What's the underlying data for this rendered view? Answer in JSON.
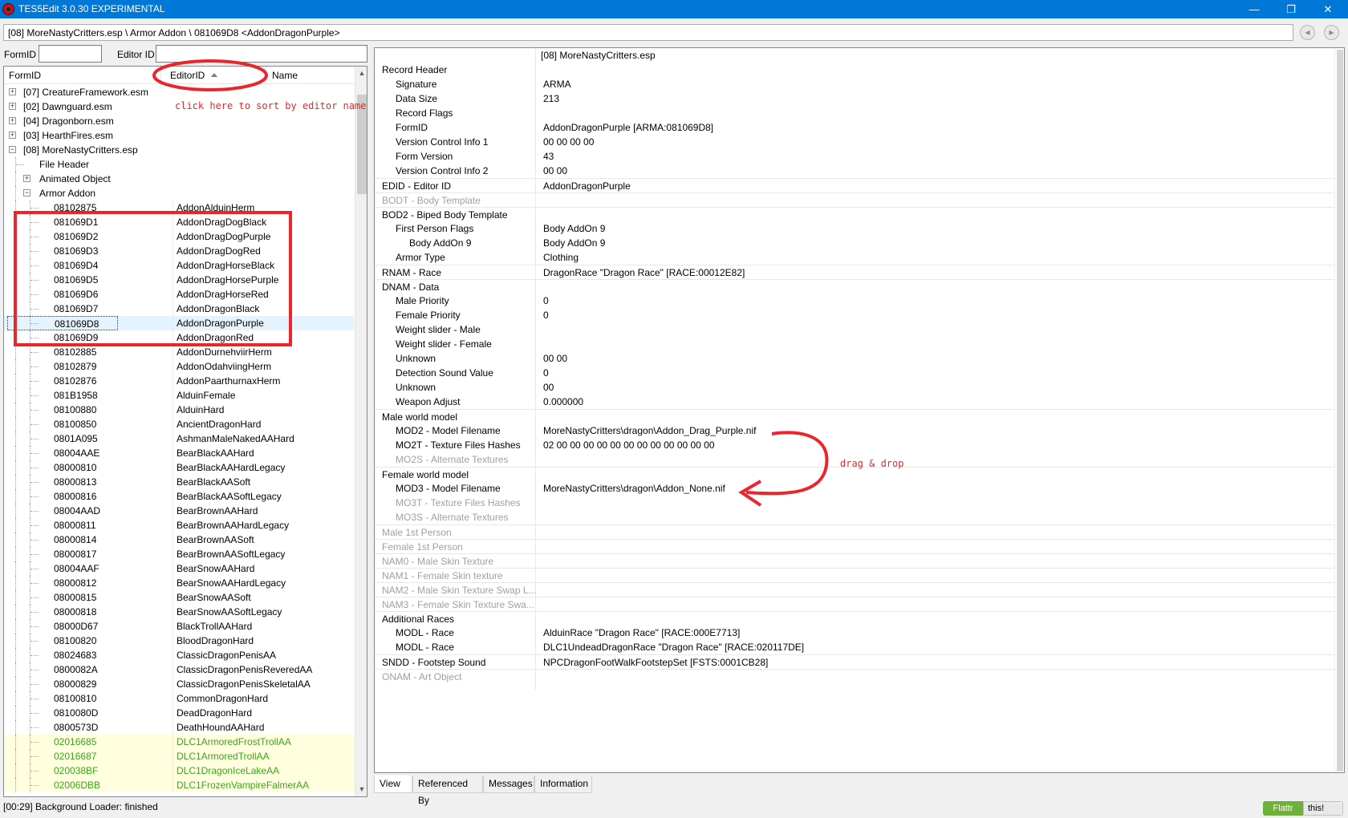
{
  "window": {
    "title": "TES5Edit 3.0.30 EXPERIMENTAL",
    "minimize": "—",
    "restore": "❐",
    "close": "✕"
  },
  "path": {
    "text": "[08] MoreNastyCritters.esp \\ Armor Addon \\ 081069D8 <AddonDragonPurple>",
    "back": "◂",
    "forward": "▸"
  },
  "filter": {
    "formid_label": "FormID",
    "formid_value": "",
    "editorid_label": "Editor ID",
    "editorid_value": ""
  },
  "tree": {
    "columns": {
      "formid": "FormID",
      "editorid": "EditorID",
      "name": "Name"
    },
    "rows": [
      {
        "fid": "[07] CreatureFramework.esm",
        "eid": "",
        "level": 0,
        "expander": "+"
      },
      {
        "fid": "[02] Dawnguard.esm",
        "eid": "",
        "level": 0,
        "expander": "+"
      },
      {
        "fid": "[04] Dragonborn.esm",
        "eid": "",
        "level": 0,
        "expander": "+"
      },
      {
        "fid": "[03] HearthFires.esm",
        "eid": "",
        "level": 0,
        "expander": "+"
      },
      {
        "fid": "[08] MoreNastyCritters.esp",
        "eid": "",
        "level": 0,
        "expander": "−"
      },
      {
        "fid": "File Header",
        "eid": "",
        "level": 1,
        "expander": ""
      },
      {
        "fid": "Animated Object",
        "eid": "",
        "level": 1,
        "expander": "+"
      },
      {
        "fid": "Armor Addon",
        "eid": "",
        "level": 1,
        "expander": "−"
      },
      {
        "fid": "08102875",
        "eid": "AddonAlduinHerm",
        "level": 2
      },
      {
        "fid": "081069D1",
        "eid": "AddonDragDogBlack",
        "level": 2
      },
      {
        "fid": "081069D2",
        "eid": "AddonDragDogPurple",
        "level": 2
      },
      {
        "fid": "081069D3",
        "eid": "AddonDragDogRed",
        "level": 2
      },
      {
        "fid": "081069D4",
        "eid": "AddonDragHorseBlack",
        "level": 2
      },
      {
        "fid": "081069D5",
        "eid": "AddonDragHorsePurple",
        "level": 2
      },
      {
        "fid": "081069D6",
        "eid": "AddonDragHorseRed",
        "level": 2
      },
      {
        "fid": "081069D7",
        "eid": "AddonDragonBlack",
        "level": 2
      },
      {
        "fid": "081069D8",
        "eid": "AddonDragonPurple",
        "level": 2,
        "selected": true
      },
      {
        "fid": "081069D9",
        "eid": "AddonDragonRed",
        "level": 2
      },
      {
        "fid": "08102885",
        "eid": "AddonDurnehviirHerm",
        "level": 2
      },
      {
        "fid": "08102879",
        "eid": "AddonOdahviingHerm",
        "level": 2
      },
      {
        "fid": "08102876",
        "eid": "AddonPaarthurnaxHerm",
        "level": 2
      },
      {
        "fid": "081B1958",
        "eid": "AlduinFemale",
        "level": 2
      },
      {
        "fid": "08100880",
        "eid": "AlduinHard",
        "level": 2
      },
      {
        "fid": "08100850",
        "eid": "AncientDragonHard",
        "level": 2
      },
      {
        "fid": "0801A095",
        "eid": "AshmanMaleNakedAAHard",
        "level": 2
      },
      {
        "fid": "08004AAE",
        "eid": "BearBlackAAHard",
        "level": 2
      },
      {
        "fid": "08000810",
        "eid": "BearBlackAAHardLegacy",
        "level": 2
      },
      {
        "fid": "08000813",
        "eid": "BearBlackAASoft",
        "level": 2
      },
      {
        "fid": "08000816",
        "eid": "BearBlackAASoftLegacy",
        "level": 2
      },
      {
        "fid": "08004AAD",
        "eid": "BearBrownAAHard",
        "level": 2
      },
      {
        "fid": "08000811",
        "eid": "BearBrownAAHardLegacy",
        "level": 2
      },
      {
        "fid": "08000814",
        "eid": "BearBrownAASoft",
        "level": 2
      },
      {
        "fid": "08000817",
        "eid": "BearBrownAASoftLegacy",
        "level": 2
      },
      {
        "fid": "08004AAF",
        "eid": "BearSnowAAHard",
        "level": 2
      },
      {
        "fid": "08000812",
        "eid": "BearSnowAAHardLegacy",
        "level": 2
      },
      {
        "fid": "08000815",
        "eid": "BearSnowAASoft",
        "level": 2
      },
      {
        "fid": "08000818",
        "eid": "BearSnowAASoftLegacy",
        "level": 2
      },
      {
        "fid": "08000D67",
        "eid": "BlackTrollAAHard",
        "level": 2
      },
      {
        "fid": "08100820",
        "eid": "BloodDragonHard",
        "level": 2
      },
      {
        "fid": "08024683",
        "eid": "ClassicDragonPenisAA",
        "level": 2
      },
      {
        "fid": "0800082A",
        "eid": "ClassicDragonPenisReveredAA",
        "level": 2
      },
      {
        "fid": "08000829",
        "eid": "ClassicDragonPenisSkeletalAA",
        "level": 2
      },
      {
        "fid": "08100810",
        "eid": "CommonDragonHard",
        "level": 2
      },
      {
        "fid": "0810080D",
        "eid": "DeadDragonHard",
        "level": 2
      },
      {
        "fid": "0800573D",
        "eid": "DeathHoundAAHard",
        "level": 2
      },
      {
        "fid": "02016685",
        "eid": "DLC1ArmoredFrostTrollAA",
        "level": 2,
        "dlc": true
      },
      {
        "fid": "02016687",
        "eid": "DLC1ArmoredTrollAA",
        "level": 2,
        "dlc": true
      },
      {
        "fid": "020038BF",
        "eid": "DLC1DragonIceLakeAA",
        "level": 2,
        "dlc": true
      },
      {
        "fid": "02006DBB",
        "eid": "DLC1FrozenVampireFalmerAA",
        "level": 2,
        "dlc": true
      }
    ]
  },
  "record": {
    "rows": [
      {
        "k": "",
        "v": "[08] MoreNastyCritters.esp",
        "indent": 0,
        "dis": false,
        "sec": false
      },
      {
        "k": "Record Header",
        "v": "",
        "indent": 0,
        "dis": false,
        "sec": false
      },
      {
        "k": "Signature",
        "v": "ARMA",
        "indent": 1,
        "dis": false,
        "sec": false
      },
      {
        "k": "Data Size",
        "v": "213",
        "indent": 1,
        "dis": false,
        "sec": false
      },
      {
        "k": "Record Flags",
        "v": "",
        "indent": 1,
        "dis": false,
        "sec": false
      },
      {
        "k": "FormID",
        "v": "AddonDragonPurple [ARMA:081069D8]",
        "indent": 1,
        "dis": false,
        "sec": false
      },
      {
        "k": "Version Control Info 1",
        "v": "00 00 00 00",
        "indent": 1,
        "dis": false,
        "sec": false
      },
      {
        "k": "Form Version",
        "v": "43",
        "indent": 1,
        "dis": false,
        "sec": false
      },
      {
        "k": "Version Control Info 2",
        "v": "00 00",
        "indent": 1,
        "dis": false,
        "sec": false
      },
      {
        "k": "EDID - Editor ID",
        "v": "AddonDragonPurple",
        "indent": 0,
        "dis": false,
        "sec": true
      },
      {
        "k": "BODT - Body Template",
        "v": "",
        "indent": 0,
        "dis": true,
        "sec": true
      },
      {
        "k": "BOD2 - Biped Body Template",
        "v": "",
        "indent": 0,
        "dis": false,
        "sec": true
      },
      {
        "k": "First Person Flags",
        "v": "Body AddOn 9",
        "indent": 1,
        "dis": false,
        "sec": false
      },
      {
        "k": "Body AddOn 9",
        "v": "Body AddOn 9",
        "indent": 2,
        "dis": false,
        "sec": false
      },
      {
        "k": "Armor Type",
        "v": "Clothing",
        "indent": 1,
        "dis": false,
        "sec": false
      },
      {
        "k": "RNAM - Race",
        "v": "DragonRace \"Dragon Race\" [RACE:00012E82]",
        "indent": 0,
        "dis": false,
        "sec": true
      },
      {
        "k": "DNAM - Data",
        "v": "",
        "indent": 0,
        "dis": false,
        "sec": true
      },
      {
        "k": "Male Priority",
        "v": "0",
        "indent": 1,
        "dis": false,
        "sec": false
      },
      {
        "k": "Female Priority",
        "v": "0",
        "indent": 1,
        "dis": false,
        "sec": false
      },
      {
        "k": "Weight slider - Male",
        "v": "",
        "indent": 1,
        "dis": false,
        "sec": false
      },
      {
        "k": "Weight slider - Female",
        "v": "",
        "indent": 1,
        "dis": false,
        "sec": false
      },
      {
        "k": "Unknown",
        "v": "00 00",
        "indent": 1,
        "dis": false,
        "sec": false
      },
      {
        "k": "Detection Sound Value",
        "v": "0",
        "indent": 1,
        "dis": false,
        "sec": false
      },
      {
        "k": "Unknown",
        "v": "00",
        "indent": 1,
        "dis": false,
        "sec": false
      },
      {
        "k": "Weapon Adjust",
        "v": "0.000000",
        "indent": 1,
        "dis": false,
        "sec": false
      },
      {
        "k": "Male world model",
        "v": "",
        "indent": 0,
        "dis": false,
        "sec": true
      },
      {
        "k": "MOD2 - Model Filename",
        "v": "MoreNastyCritters\\dragon\\Addon_Drag_Purple.nif",
        "indent": 1,
        "dis": false,
        "sec": false
      },
      {
        "k": "MO2T - Texture Files Hashes",
        "v": "02 00 00 00 00 00 00 00 00 00 00 00 00",
        "indent": 1,
        "dis": false,
        "sec": false
      },
      {
        "k": "MO2S - Alternate Textures",
        "v": "",
        "indent": 1,
        "dis": true,
        "sec": false
      },
      {
        "k": "Female world model",
        "v": "",
        "indent": 0,
        "dis": false,
        "sec": true
      },
      {
        "k": "MOD3 - Model Filename",
        "v": "MoreNastyCritters\\dragon\\Addon_None.nif",
        "indent": 1,
        "dis": false,
        "sec": false
      },
      {
        "k": "MO3T - Texture Files Hashes",
        "v": "",
        "indent": 1,
        "dis": true,
        "sec": false
      },
      {
        "k": "MO3S - Alternate Textures",
        "v": "",
        "indent": 1,
        "dis": true,
        "sec": false
      },
      {
        "k": "Male 1st Person",
        "v": "",
        "indent": 0,
        "dis": true,
        "sec": true
      },
      {
        "k": "Female 1st Person",
        "v": "",
        "indent": 0,
        "dis": true,
        "sec": true
      },
      {
        "k": "NAM0 - Male Skin Texture",
        "v": "",
        "indent": 0,
        "dis": true,
        "sec": true
      },
      {
        "k": "NAM1 - Female Skin texture",
        "v": "",
        "indent": 0,
        "dis": true,
        "sec": true
      },
      {
        "k": "NAM2 - Male Skin Texture Swap L...",
        "v": "",
        "indent": 0,
        "dis": true,
        "sec": true
      },
      {
        "k": "NAM3 - Female Skin Texture Swa...",
        "v": "",
        "indent": 0,
        "dis": true,
        "sec": true
      },
      {
        "k": "Additional Races",
        "v": "",
        "indent": 0,
        "dis": false,
        "sec": true
      },
      {
        "k": "MODL - Race",
        "v": "AlduinRace \"Dragon Race\" [RACE:000E7713]",
        "indent": 1,
        "dis": false,
        "sec": false
      },
      {
        "k": "MODL - Race",
        "v": "DLC1UndeadDragonRace \"Dragon Race\" [RACE:020117DE]",
        "indent": 1,
        "dis": false,
        "sec": false
      },
      {
        "k": "SNDD - Footstep Sound",
        "v": "NPCDragonFootWalkFootstepSet [FSTS:0001CB28]",
        "indent": 0,
        "dis": false,
        "sec": true
      },
      {
        "k": "ONAM - Art Object",
        "v": "",
        "indent": 0,
        "dis": true,
        "sec": true
      }
    ]
  },
  "tabs": [
    "View",
    "Referenced By",
    "Messages",
    "Information"
  ],
  "status": {
    "text": "[00:29] Background Loader: finished",
    "flattr_left": "Flattr",
    "flattr_right": "this!"
  },
  "annotations": {
    "sort_hint": "click here to sort by editor name",
    "drag_hint": "drag & drop"
  },
  "colors": {
    "titlebar": "#0078d7",
    "annotation_red": "#e8262b",
    "dlc_green": "#3ba51b",
    "dlc_bg": "#ffffe0",
    "selected_bg": "#e5f3ff"
  }
}
